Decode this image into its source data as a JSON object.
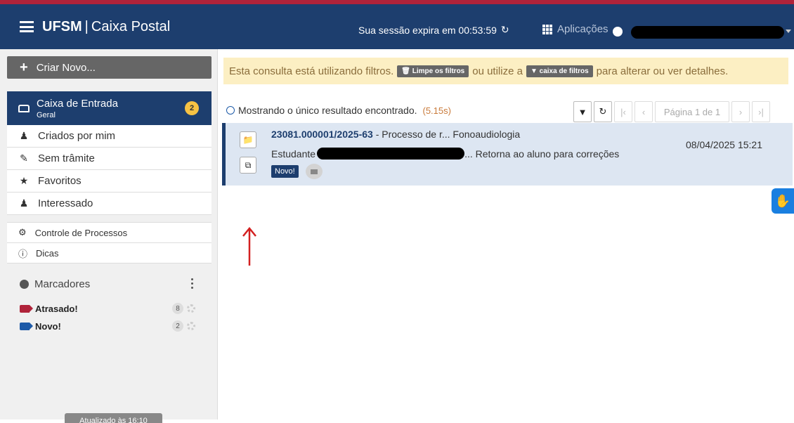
{
  "header": {
    "brand_strong": "UFSM",
    "brand_sep": "|",
    "brand_app": "Caixa Postal",
    "session_text": "Sua sessão expira em 00:53:59",
    "apps_label": "Aplicações"
  },
  "sidebar": {
    "create_label": "Criar Novo...",
    "inbox_title": "Caixa de Entrada",
    "inbox_sub": "Geral",
    "inbox_count": "2",
    "items": [
      {
        "label": "Criados por mim",
        "icon": "user-check-icon"
      },
      {
        "label": "Sem trâmite",
        "icon": "edit-icon"
      },
      {
        "label": "Favoritos",
        "icon": "star-icon"
      },
      {
        "label": "Interessado",
        "icon": "users-icon"
      }
    ],
    "items2": [
      {
        "label": "Controle de Processos",
        "icon": "gear-icon"
      },
      {
        "label": "Dicas",
        "icon": "info-icon"
      }
    ],
    "markers_title": "Marcadores",
    "tags": [
      {
        "label": "Atrasado!",
        "count": "8",
        "color": "#b0233a"
      },
      {
        "label": "Novo!",
        "count": "2",
        "color": "#1d5aa8"
      }
    ],
    "updated_label": "Atualizado às 16:10"
  },
  "main": {
    "alert_pre": "Esta consulta está utilizando filtros.",
    "alert_btn1": "Limpe os filtros",
    "alert_mid": "ou utilize a",
    "alert_btn2": "caixa de filtros",
    "alert_post": "para alterar ou ver detalhes.",
    "result_text": "Mostrando o único resultado encontrado.",
    "result_time": "(5.15s)",
    "page_label": "Página 1 de 1",
    "row": {
      "number": "23081.000001/2025-63",
      "desc": " - Processo de r...  Fonoaudiologia",
      "line2_pre": "Estudante",
      "line2_post": "... Retorna ao aluno para correções",
      "date": "08/04/2025 15:21",
      "badge": "Novo!"
    }
  },
  "colors": {
    "header": "#1d3e6e",
    "accent_red": "#b0233a",
    "alert_bg": "#fcefc3"
  }
}
